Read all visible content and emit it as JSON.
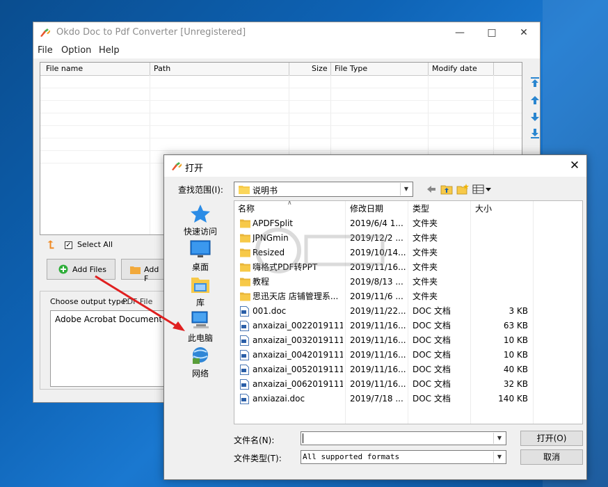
{
  "main_window": {
    "title": "Okdo Doc to Pdf Converter [Unregistered]",
    "menu": [
      "File",
      "Option",
      "Help"
    ],
    "columns": [
      "File name",
      "Path",
      "Size",
      "File Type",
      "Modify date"
    ],
    "select_all_label": "Select All",
    "select_all_checked": true,
    "add_files_label": "Add Files",
    "add_folder_label": "Add F",
    "output_type_label": "Choose output type:",
    "output_type_value": "PDF File",
    "output_list_item": "Adobe Acrobat Document (*."
  },
  "dialog": {
    "title": "打开",
    "look_in_label": "查找范围(I):",
    "look_in_value": "说明书",
    "places": [
      "快速访问",
      "桌面",
      "库",
      "此电脑",
      "网络"
    ],
    "columns": [
      "名称",
      "修改日期",
      "类型",
      "大小"
    ],
    "files": [
      {
        "name": "APDFSplit",
        "date": "2019/6/4 1...",
        "type": "文件夹",
        "size": "",
        "kind": "folder"
      },
      {
        "name": "JPNGmin",
        "date": "2019/12/2 ...",
        "type": "文件夹",
        "size": "",
        "kind": "folder"
      },
      {
        "name": "Resized",
        "date": "2019/10/14...",
        "type": "文件夹",
        "size": "",
        "kind": "folder"
      },
      {
        "name": "嗨格式PDF转PPT",
        "date": "2019/11/16...",
        "type": "文件夹",
        "size": "",
        "kind": "folder"
      },
      {
        "name": "教程",
        "date": "2019/8/13 ...",
        "type": "文件夹",
        "size": "",
        "kind": "folder"
      },
      {
        "name": "思迅天店 店铺管理系...",
        "date": "2019/11/6 ...",
        "type": "文件夹",
        "size": "",
        "kind": "folder"
      },
      {
        "name": "001.doc",
        "date": "2019/11/22...",
        "type": "DOC 文档",
        "size": "3 KB",
        "kind": "doc"
      },
      {
        "name": "anxaizai_0022019111...",
        "date": "2019/11/16...",
        "type": "DOC 文档",
        "size": "63 KB",
        "kind": "doc"
      },
      {
        "name": "anxaizai_0032019111...",
        "date": "2019/11/16...",
        "type": "DOC 文档",
        "size": "10 KB",
        "kind": "doc"
      },
      {
        "name": "anxaizai_0042019111...",
        "date": "2019/11/16...",
        "type": "DOC 文档",
        "size": "10 KB",
        "kind": "doc"
      },
      {
        "name": "anxaizai_0052019111...",
        "date": "2019/11/16...",
        "type": "DOC 文档",
        "size": "40 KB",
        "kind": "doc"
      },
      {
        "name": "anxaizai_0062019111...",
        "date": "2019/11/16...",
        "type": "DOC 文档",
        "size": "32 KB",
        "kind": "doc"
      },
      {
        "name": "anxiazai.doc",
        "date": "2019/7/18 ...",
        "type": "DOC 文档",
        "size": "140 KB",
        "kind": "doc"
      }
    ],
    "file_name_label": "文件名(N):",
    "file_name_value": "",
    "file_type_label": "文件类型(T):",
    "file_type_value": "All supported formats",
    "open_button": "打开(O)",
    "cancel_button": "取消"
  },
  "colors": {
    "annotation_arrow": "#e02020",
    "folder": "#f7c948",
    "add_files_icon": "#2fae3a"
  }
}
